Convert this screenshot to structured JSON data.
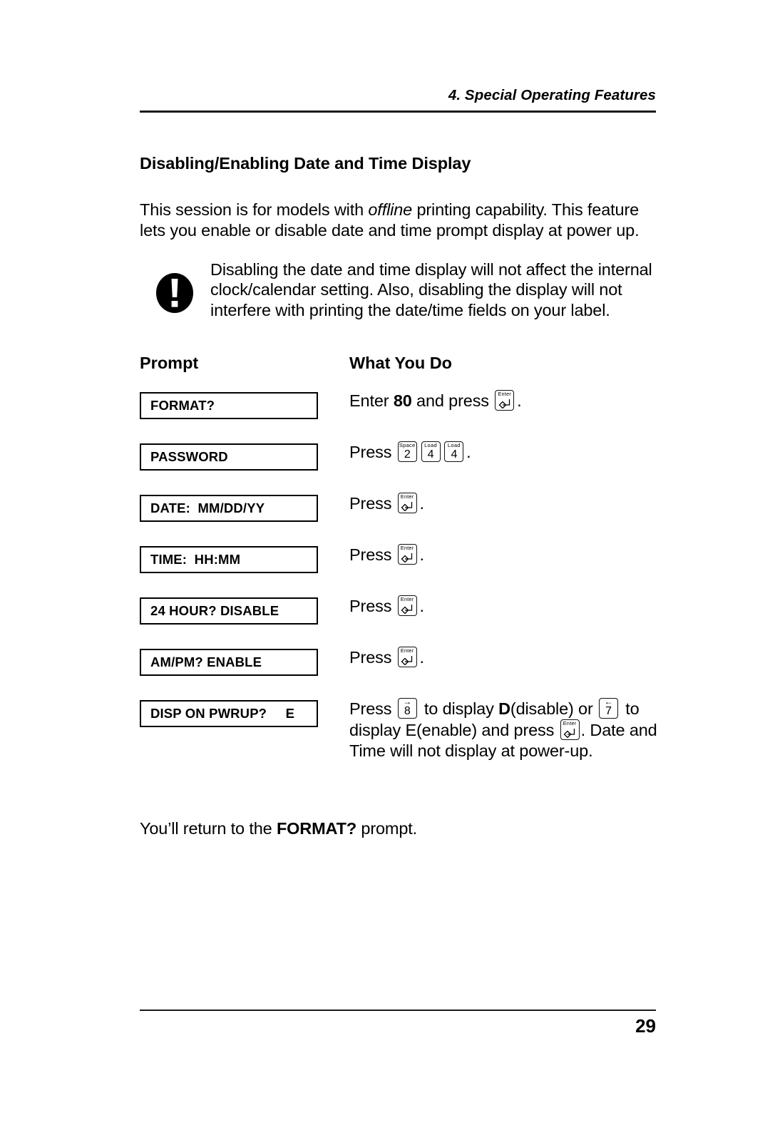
{
  "header": {
    "running_head": "4.  Special Operating Features"
  },
  "section": {
    "heading": "Disabling/Enabling Date and Time Display",
    "intro_part1": "This session is for models with ",
    "intro_italic": "offline",
    "intro_part2": " printing capability.  This feature lets you enable or disable date and time prompt display at power up."
  },
  "note": {
    "icon": "exclamation-circle-icon",
    "text": "Disabling the date and time display will not affect the internal clock/calendar setting.  Also, disabling the display will not interfere with printing the date/time fields on your label."
  },
  "columns": {
    "prompt_heading": "Prompt",
    "what_you_do_heading": "What You Do"
  },
  "steps": [
    {
      "prompt": "FORMAT?",
      "action_prefix": "Enter ",
      "action_bold": "80",
      "action_mid": " and press ",
      "keys": [
        {
          "cap": "Enter",
          "glyph": "enter-arrow",
          "name": "enter-key-icon"
        }
      ],
      "action_suffix": "."
    },
    {
      "prompt": "PASSWORD",
      "action_prefix": "Press ",
      "keys": [
        {
          "cap": "Space",
          "digit": "2",
          "name": "space-2-key-icon"
        },
        {
          "cap": "Load",
          "digit": "4",
          "name": "load-4-key-icon"
        },
        {
          "cap": "Load",
          "digit": "4",
          "name": "load-4-key-icon"
        }
      ],
      "action_suffix": "."
    },
    {
      "prompt": "DATE:  MM/DD/YY",
      "action_prefix": "Press ",
      "keys": [
        {
          "cap": "Enter",
          "glyph": "enter-arrow",
          "name": "enter-key-icon"
        }
      ],
      "action_suffix": "."
    },
    {
      "prompt": "TIME:  HH:MM",
      "action_prefix": "Press ",
      "keys": [
        {
          "cap": "Enter",
          "glyph": "enter-arrow",
          "name": "enter-key-icon"
        }
      ],
      "action_suffix": "."
    },
    {
      "prompt": "24 HOUR? DISABLE",
      "action_prefix": "Press ",
      "keys": [
        {
          "cap": "Enter",
          "glyph": "enter-arrow",
          "name": "enter-key-icon"
        }
      ],
      "action_suffix": "."
    },
    {
      "prompt": "AM/PM? ENABLE",
      "action_prefix": "Press ",
      "keys": [
        {
          "cap": "Enter",
          "glyph": "enter-arrow",
          "name": "enter-key-icon"
        }
      ],
      "action_suffix": "."
    },
    {
      "prompt": "DISP ON PWRUP?     E",
      "action_prefix": "Press ",
      "keys": [
        {
          "cap": "→",
          "digit": "8",
          "name": "right-arrow-8-key-icon"
        }
      ],
      "action_mid1": " to display ",
      "action_bold": "D",
      "action_mid2": "(disable) or ",
      "keys2": [
        {
          "cap": "←",
          "digit": "7",
          "name": "left-arrow-7-key-icon"
        }
      ],
      "action_mid3": " to display E(enable) and press ",
      "keys3": [
        {
          "cap": "Enter",
          "glyph": "enter-arrow",
          "name": "enter-key-icon"
        }
      ],
      "action_suffix": ".  Date and Time will not display at power-up."
    }
  ],
  "closing": {
    "prefix": "You’ll return to the ",
    "bold": "FORMAT?",
    "suffix": " prompt."
  },
  "footer": {
    "page_number": "29"
  }
}
